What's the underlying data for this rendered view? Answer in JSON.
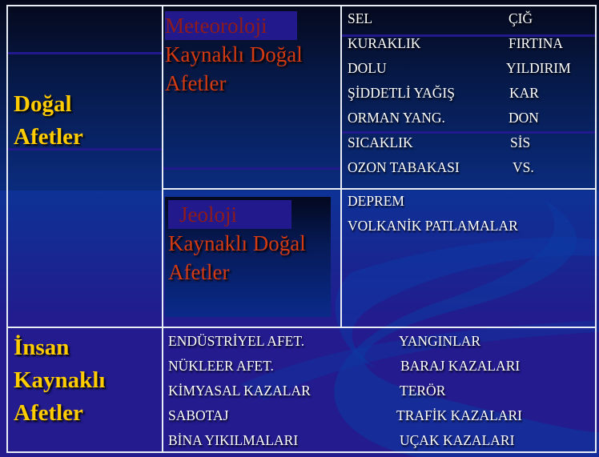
{
  "natural": {
    "label_line1": "Doğal",
    "label_line2": "Afetler",
    "meteorological": {
      "title_highlight": "Meteoroloji",
      "title_line2": "Kaynaklı Doğal",
      "title_line3": "Afetler",
      "items": [
        [
          "SEL",
          "ÇIĞ"
        ],
        [
          "KURAKLIK",
          "FIRTINA"
        ],
        [
          "DOLU",
          "YILDIRIM"
        ],
        [
          "ŞİDDETLİ  YAĞIŞ",
          "KAR"
        ],
        [
          "ORMAN YANG.",
          "DON"
        ],
        [
          "SICAKLIK",
          "SİS"
        ],
        [
          "OZON TABAKASI",
          "VS."
        ]
      ]
    },
    "geological": {
      "title_highlight": "Jeoloji",
      "title_line2": "Kaynaklı Doğal",
      "title_line3": "Afetler",
      "items": [
        "DEPREM",
        "VOLKANİK PATLAMALAR"
      ]
    }
  },
  "human": {
    "label_line1": "İnsan",
    "label_line2": "Kaynaklı",
    "label_line3": "Afetler",
    "items": [
      [
        "ENDÜSTRİYEL AFET.",
        "YANGINLAR"
      ],
      [
        "NÜKLEER AFET.",
        "BARAJ KAZALARI"
      ],
      [
        "KİMYASAL KAZALAR",
        "TERÖR"
      ],
      [
        "SABOTAJ",
        "TRAFİK KAZALARI"
      ],
      [
        "BİNA YIKILMALARI",
        "UÇAK KAZALARI"
      ]
    ]
  }
}
